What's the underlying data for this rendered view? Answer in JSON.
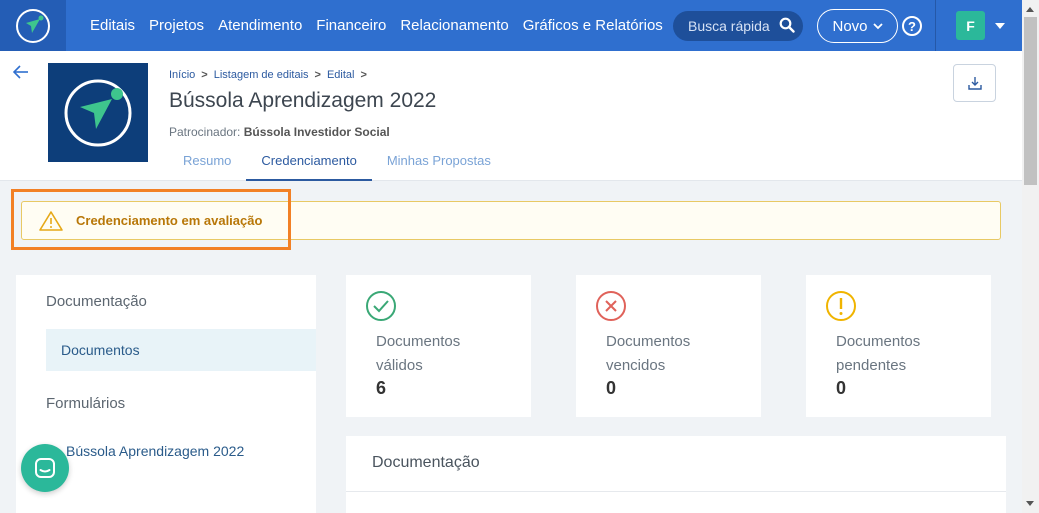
{
  "nav": {
    "links": [
      "Editais",
      "Projetos",
      "Atendimento",
      "Financeiro",
      "Relacionamento",
      "Gráficos e Relatórios"
    ],
    "search_placeholder": "Busca rápida",
    "novo_label": "Novo",
    "help_label": "?",
    "avatar_initial": "F"
  },
  "breadcrumb": {
    "items": [
      "Início",
      "Listagem de editais",
      "Edital"
    ],
    "separator": ">"
  },
  "edital": {
    "title": "Bússola Aprendizagem 2022",
    "sponsor_label": "Patrocinador:",
    "sponsor_name": "Bússola Investidor Social"
  },
  "tabs": [
    "Resumo",
    "Credenciamento",
    "Minhas Propostas"
  ],
  "alert": {
    "text": "Credenciamento em avaliação"
  },
  "sidebar": {
    "section1": "Documentação",
    "item1": "Documentos",
    "section2": "Formulários",
    "link1": "Bússola Aprendizagem 2022"
  },
  "cards": [
    {
      "label": "Documentos válidos",
      "value": "6",
      "icon": "check-circle-icon",
      "color": "#3aa876"
    },
    {
      "label": "Documentos vencidos",
      "value": "0",
      "icon": "x-circle-icon",
      "color": "#e0625a"
    },
    {
      "label": "Documentos pendentes",
      "value": "0",
      "icon": "exclamation-circle-icon",
      "color": "#f0b400"
    }
  ],
  "doc_panel": {
    "heading": "Documentação"
  },
  "colors": {
    "nav": "#2f6fcf",
    "accent": "#2c5aa0",
    "alert_text": "#b87708",
    "highlight": "#f28025",
    "chat": "#2bb89a"
  }
}
